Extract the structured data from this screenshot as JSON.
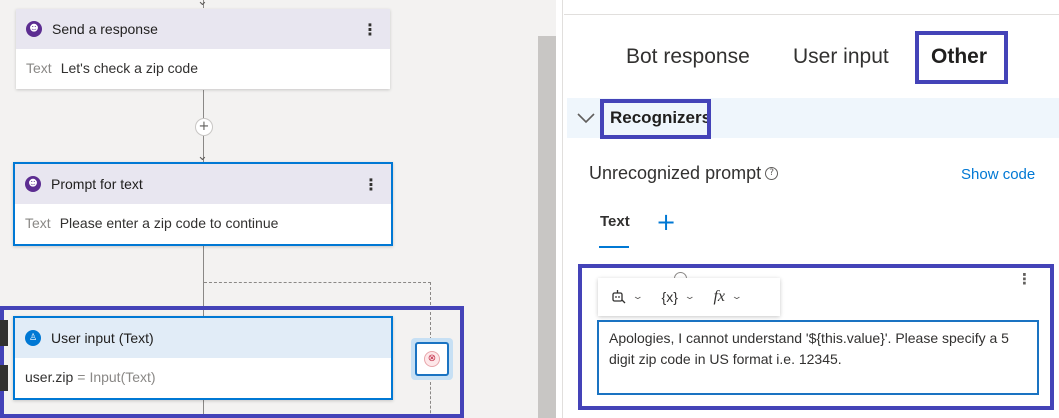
{
  "canvas": {
    "nodes": [
      {
        "title": "Send a response",
        "body_label": "Text",
        "body_value": "Let's check a zip code",
        "icon": "bot-icon"
      },
      {
        "title": "Prompt for text",
        "body_label": "Text",
        "body_value": "Please enter a zip code to continue",
        "icon": "bot-icon"
      },
      {
        "title": "User input (Text)",
        "body_var": "user.zip",
        "body_eq": "=",
        "body_value": "Input(Text)",
        "icon": "user-icon"
      }
    ],
    "add_symbol": "+",
    "more_symbol": "⋮"
  },
  "pane": {
    "tabs": [
      {
        "label": "Bot response",
        "active": false
      },
      {
        "label": "User input",
        "active": false
      },
      {
        "label": "Other",
        "active": true
      }
    ],
    "section": {
      "title": "Recognizers",
      "expanded": true
    },
    "property": {
      "label": "Unrecognized prompt",
      "help": "?",
      "show_code": "Show code"
    },
    "subtabs": {
      "active": "Text",
      "add": "+"
    },
    "editor": {
      "toolbar": {
        "variable": "{x}",
        "function": "fx"
      },
      "value": "Apologies, I cannot understand '${this.value}'. Please specify a 5 digit zip code in US format i.e. 12345."
    }
  },
  "colors": {
    "highlight": "#4443b8",
    "accent": "#0078d4",
    "node_header": "#e8e6f0",
    "section_bg": "#eff6fc"
  }
}
